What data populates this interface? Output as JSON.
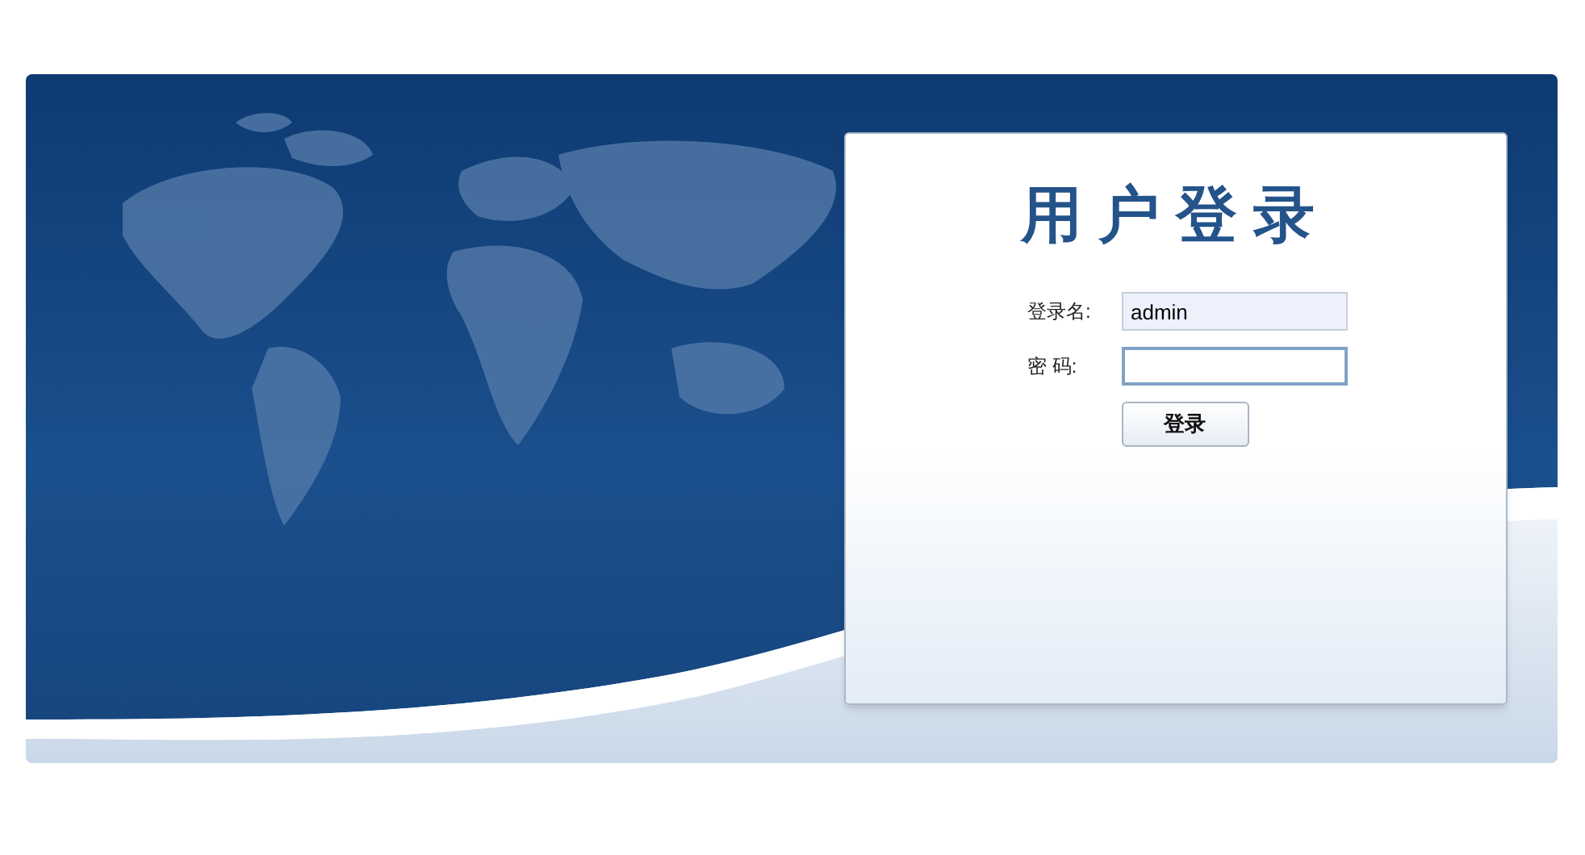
{
  "login": {
    "title": "用户登录",
    "fields": [
      {
        "label": "登录名:",
        "value": "admin",
        "focused": false,
        "kind": "text"
      },
      {
        "label": "密 码:",
        "focused": true,
        "kind": "password"
      }
    ],
    "button": "登录"
  }
}
